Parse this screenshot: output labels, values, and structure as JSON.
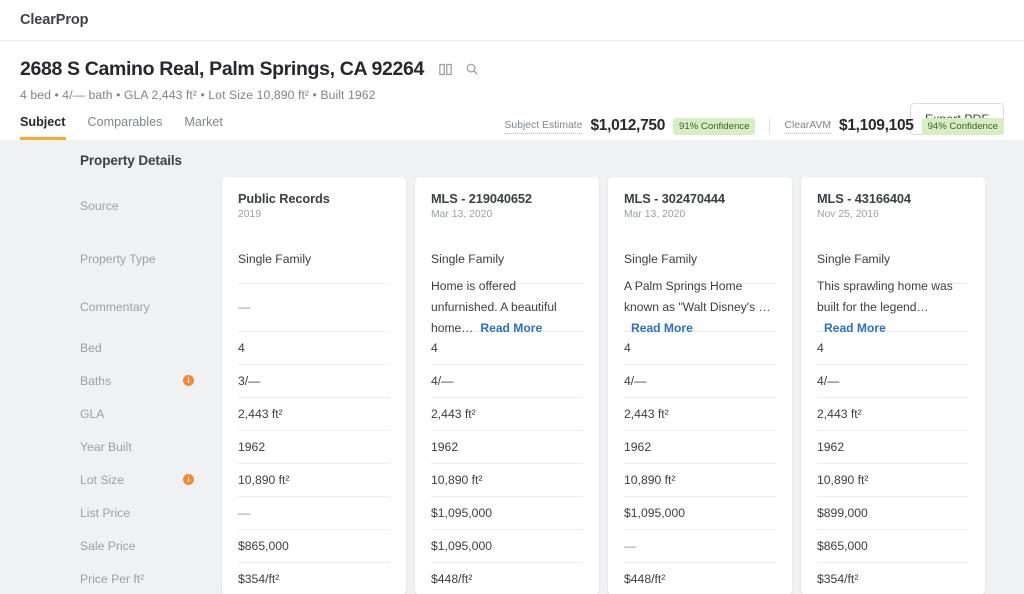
{
  "brand": {
    "name": "ClearProp"
  },
  "header": {
    "address": "2688 S Camino Real, Palm Springs, CA 92264",
    "summary": "4 bed • 4/— bath • GLA 2,443 ft² • Lot Size 10,890 ft² • Built 1962",
    "map_icon": "book-map-icon",
    "search_icon": "search-icon",
    "export_label": "Export PDF",
    "tabs": [
      {
        "label": "Subject",
        "active": true
      },
      {
        "label": "Comparables",
        "active": false
      },
      {
        "label": "Market",
        "active": false
      }
    ],
    "estimates": [
      {
        "label": "Subject Estimate",
        "value": "$1,012,750",
        "confidence": "91% Confidence"
      },
      {
        "label": "ClearAVM",
        "value": "$1,109,105",
        "confidence": "94% Confidence"
      }
    ]
  },
  "section": {
    "title": "Property Details"
  },
  "rows": [
    {
      "label": "Source",
      "warn": false
    },
    {
      "label": "Property Type",
      "warn": false
    },
    {
      "label": "Commentary",
      "warn": false
    },
    {
      "label": "Bed",
      "warn": false
    },
    {
      "label": "Baths",
      "warn": true
    },
    {
      "label": "GLA",
      "warn": false
    },
    {
      "label": "Year Built",
      "warn": false
    },
    {
      "label": "Lot Size",
      "warn": true
    },
    {
      "label": "List Price",
      "warn": false
    },
    {
      "label": "Sale Price",
      "warn": false
    },
    {
      "label": "Price Per ft²",
      "warn": false
    }
  ],
  "columns": [
    {
      "title": "Public Records",
      "date": "2019",
      "property_type": "Single Family",
      "commentary": "—",
      "commentary_link": "",
      "bed": "4",
      "baths": "3/—",
      "gla": "2,443 ft²",
      "year_built": "1962",
      "lot_size": "10,890 ft²",
      "list_price": "—",
      "sale_price": "$865,000",
      "price_per_ft": "$354/ft²"
    },
    {
      "title": "MLS - 219040652",
      "date": "Mar 13, 2020",
      "property_type": "Single Family",
      "commentary": "Home is offered unfurnished. A beautiful home…",
      "commentary_link": "Read More",
      "bed": "4",
      "baths": "4/—",
      "gla": "2,443 ft²",
      "year_built": "1962",
      "lot_size": "10,890 ft²",
      "list_price": "$1,095,000",
      "sale_price": "$1,095,000",
      "price_per_ft": "$448/ft²"
    },
    {
      "title": "MLS - 302470444",
      "date": "Mar 13, 2020",
      "property_type": "Single Family",
      "commentary": "A Palm Springs Home known as \"Walt Disney's …",
      "commentary_link": "Read More",
      "bed": "4",
      "baths": "4/—",
      "gla": "2,443 ft²",
      "year_built": "1962",
      "lot_size": "10,890 ft²",
      "list_price": "$1,095,000",
      "sale_price": "—",
      "price_per_ft": "$448/ft²"
    },
    {
      "title": "MLS - 43166404",
      "date": "Nov 25, 2016",
      "property_type": "Single Family",
      "commentary": "This sprawling home was built for the legend…",
      "commentary_link": "Read More",
      "bed": "4",
      "baths": "4/—",
      "gla": "2,443 ft²",
      "year_built": "1962",
      "lot_size": "10,890 ft²",
      "list_price": "$899,000",
      "sale_price": "$865,000",
      "price_per_ft": "$354/ft²"
    }
  ],
  "colors": {
    "accent": "#f5ab2e",
    "warning": "#f58634",
    "link": "#2b72c4",
    "badge_bg": "#d7eec4",
    "badge_text": "#3f6126",
    "page_bg": "#f0f1f3"
  }
}
